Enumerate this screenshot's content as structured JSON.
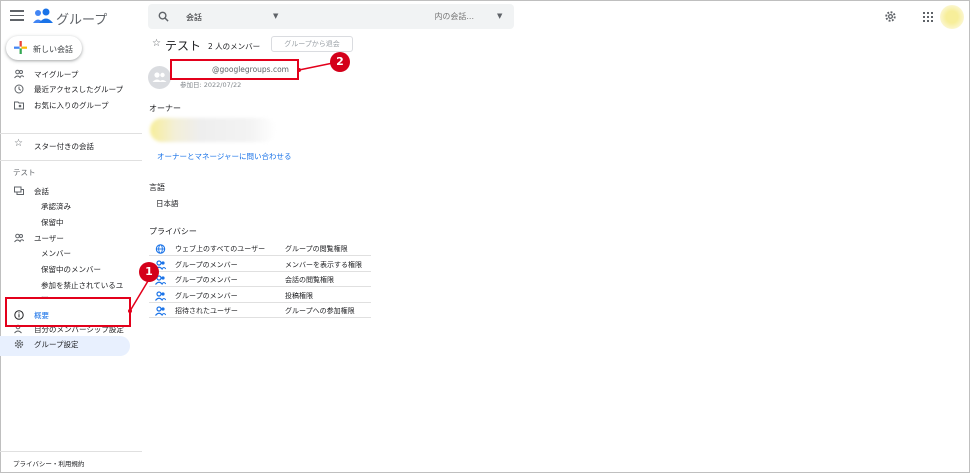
{
  "app": {
    "name": "グループ"
  },
  "search": {
    "scope": "会話",
    "placeholder": "内の会話..."
  },
  "sidebar": {
    "new_conversation": "新しい会話",
    "nav": [
      {
        "label": "マイグループ",
        "icon": "people-icon"
      },
      {
        "label": "最近アクセスしたグループ",
        "icon": "clock-icon"
      },
      {
        "label": "お気に入りのグループ",
        "icon": "folder-star-icon"
      }
    ],
    "starred": "スター付きの会話",
    "section_title": "テスト",
    "conversations": "会話",
    "conversation_sub": [
      "承認済み",
      "保留中"
    ],
    "users": "ユーザー",
    "user_sub": [
      "メンバー",
      "保留中のメンバー",
      "参加を禁止されているユ",
      "ー"
    ],
    "overview": "概要",
    "membership_settings": "自分のメンバーシップ設定",
    "group_settings": "グループ設定",
    "footer": "プライバシー・利用規約"
  },
  "main": {
    "title": "テスト",
    "member_count": "2 人のメンバー",
    "leave_button": "グループから退会",
    "email": "@googlegroups.com",
    "joined": "参加日: 2022/07/22",
    "owner_heading": "オーナー",
    "contact_link": "オーナーとマネージャーに問い合わせる",
    "language_heading": "言語",
    "language_value": "日本語",
    "privacy_heading": "プライバシー",
    "privacy_rows": [
      {
        "who": "ウェブ上のすべてのユーザー",
        "permission": "グループの閲覧権限",
        "icon": "globe-icon"
      },
      {
        "who": "グループのメンバー",
        "permission": "メンバーを表示する権限",
        "icon": "people-icon"
      },
      {
        "who": "グループのメンバー",
        "permission": "会話の閲覧権限",
        "icon": "people-icon"
      },
      {
        "who": "グループのメンバー",
        "permission": "投稿権限",
        "icon": "people-icon"
      },
      {
        "who": "招待されたユーザー",
        "permission": "グループへの参加権限",
        "icon": "people-icon"
      }
    ]
  },
  "annotations": {
    "marker_1": "1",
    "marker_2": "2"
  },
  "colors": {
    "accent": "#1a73e8",
    "annotation": "#e3001b",
    "active_bg": "#e8f0fe"
  }
}
